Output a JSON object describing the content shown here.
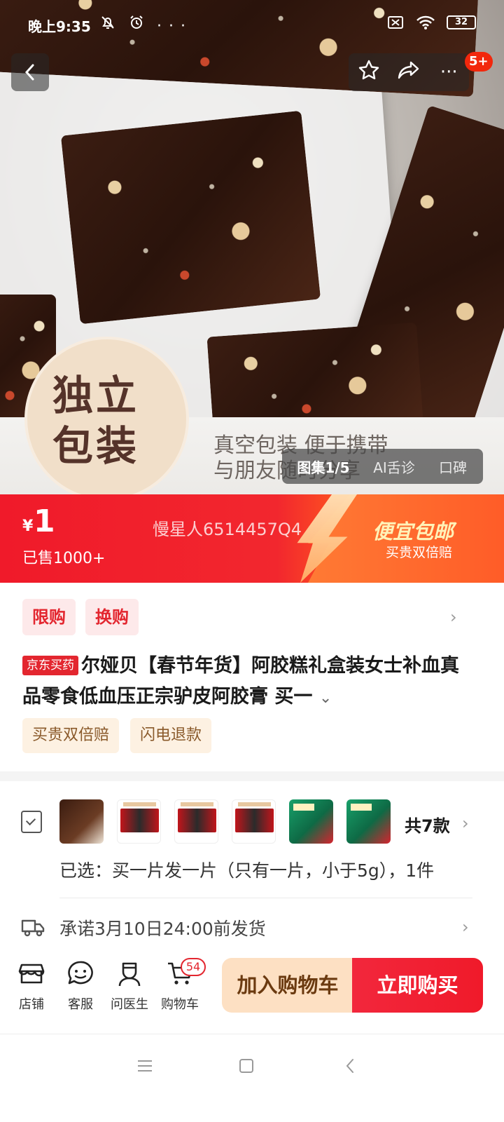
{
  "status_bar": {
    "time": "晚上9:35",
    "ellipsis": "···",
    "battery_level": "32"
  },
  "top_nav": {
    "more_label": "···",
    "notification_count": "5+"
  },
  "hero": {
    "badge_line1": "独立",
    "badge_line2": "包装",
    "caption_line1": "真空包装 便于携带",
    "caption_line2": "与朋友随时分享",
    "gallery_tabs": [
      "图集1/5",
      "AI舌诊",
      "口碑"
    ]
  },
  "price": {
    "currency": "¥",
    "value": "1",
    "sold": "已售1000+",
    "watermark": "慢星人6514457Q4",
    "promo_title": "便宜包邮",
    "promo_subtitle": "买贵双倍赔"
  },
  "tags": [
    "限购",
    "换购"
  ],
  "product": {
    "store_tag": "京东买药",
    "title": "尔娅贝【春节年货】阿胶糕礼盒装女士补血真品零食低血压正宗驴皮阿胶膏 买一"
  },
  "services": [
    "买贵双倍赔",
    "闪电退款"
  ],
  "variants": {
    "count_label": "共7款",
    "selected": "已选：买一片发一片（只有一片，小于5g），1件"
  },
  "shipping": {
    "text": "承诺3月10日24:00前发货"
  },
  "bottom_bar": {
    "store": "店铺",
    "service": "客服",
    "doctor": "问医生",
    "cart": "购物车",
    "cart_count": "54",
    "add_to_cart": "加入购物车",
    "buy_now": "立即购买"
  },
  "colors": {
    "accent_red": "#f01a2a",
    "promo_orange": "#ff5a27",
    "tag_bg": "#fde9ea",
    "service_bg": "#fdf1e2"
  }
}
